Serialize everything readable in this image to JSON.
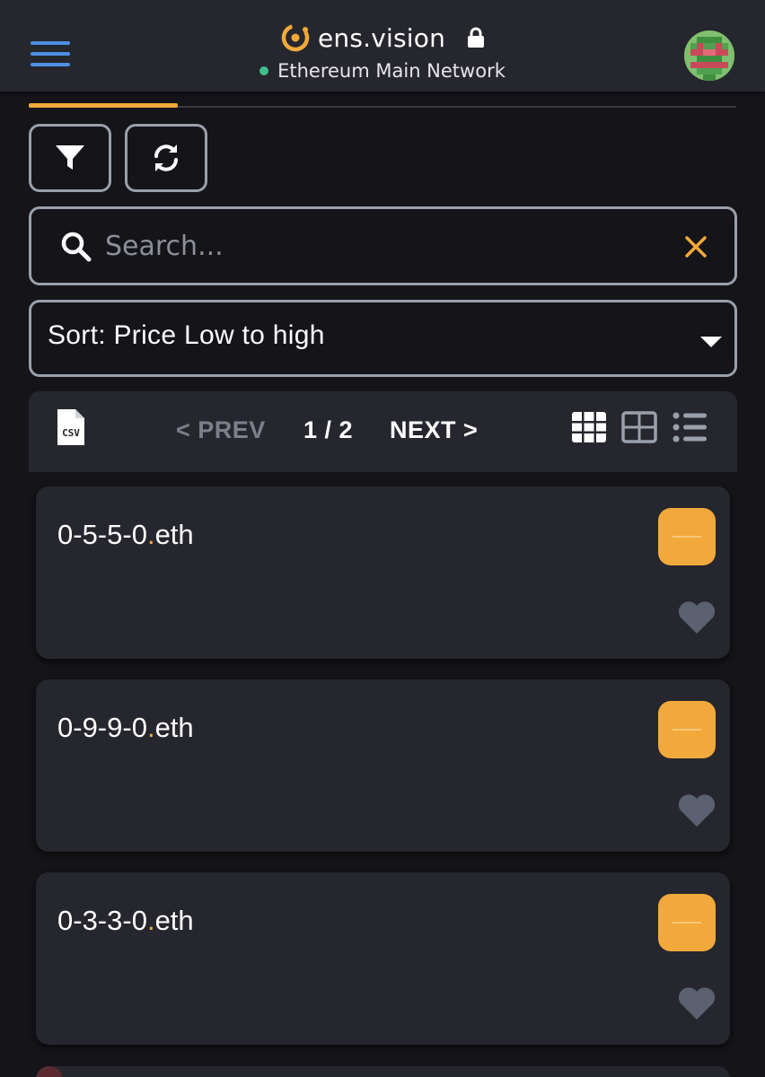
{
  "header": {
    "brand_name": "ens.vision",
    "network": "Ethereum Main Network",
    "network_status_color": "#3fbf8a",
    "brand_accent": "#f2a93b"
  },
  "toolbar": {
    "filter_icon": "filter-icon",
    "refresh_icon": "refresh-icon"
  },
  "search": {
    "placeholder": "Search...",
    "value": ""
  },
  "sort": {
    "label": "Sort: Price Low to high"
  },
  "pager": {
    "export_icon": "csv-icon",
    "prev_label": "< PREV",
    "page_label": "1 / 2",
    "next_label": "NEXT >",
    "views": [
      "large-grid-icon",
      "small-grid-icon",
      "list-icon"
    ],
    "active_view": "large-grid-icon"
  },
  "cards": [
    {
      "name": "0-5-5-0",
      "dot": ".",
      "tld": "eth"
    },
    {
      "name": "0-9-9-0",
      "dot": ".",
      "tld": "eth"
    },
    {
      "name": "0-3-3-0",
      "dot": ".",
      "tld": "eth"
    }
  ]
}
